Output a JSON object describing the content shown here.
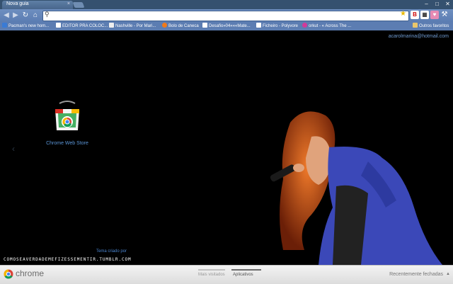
{
  "tab": {
    "title": "Nova guia",
    "close": "×"
  },
  "window_controls": {
    "minimize": "–",
    "maximize": "□",
    "close": "✕"
  },
  "nav": {
    "back": "◀",
    "forward": "▶",
    "reload": "↻",
    "home": "⌂"
  },
  "omnibox": {
    "value": "",
    "placeholder": ""
  },
  "bookmarks": [
    {
      "label": "Pacman's new hom...",
      "color": "#3a7bd5"
    },
    {
      "label": "EDITOR PRA COLOC...",
      "color": "#ffffff"
    },
    {
      "label": "Nashville - Por Mari...",
      "color": "#f2f2f2"
    },
    {
      "label": "Bolo de Caneca",
      "color": "#f07a1a"
    },
    {
      "label": "Desafio»04«««Mate...",
      "color": "#ffffff"
    },
    {
      "label": "Ficheiro - Polyvore",
      "color": "#ffffff"
    },
    {
      "label": "orkut - « Across The ...",
      "color": "#d23a9a"
    }
  ],
  "bookmarks_other": "Outros favoritos",
  "user_email": "acarolmarina@hotmail.com",
  "app": {
    "label": "Chrome Web Store"
  },
  "theme": {
    "by": "Tema criado por",
    "url": "COMOSEAVERDADEMEFIZESSEMENTIR.TUMBLR.COM"
  },
  "footer": {
    "brand": "chrome",
    "tabs": [
      {
        "label": "Mais visitados",
        "active": false
      },
      {
        "label": "Aplicativos",
        "active": true
      }
    ],
    "recent": "Recentemente fechadas"
  },
  "colors": {
    "accent": "#5b7db2",
    "link": "#5b95d6"
  },
  "icons": [
    "search-icon",
    "star-icon",
    "home-icon",
    "reload-icon",
    "back-icon",
    "forward-icon",
    "folder-icon",
    "chrome-web-store-icon",
    "chrome-logo-icon"
  ]
}
